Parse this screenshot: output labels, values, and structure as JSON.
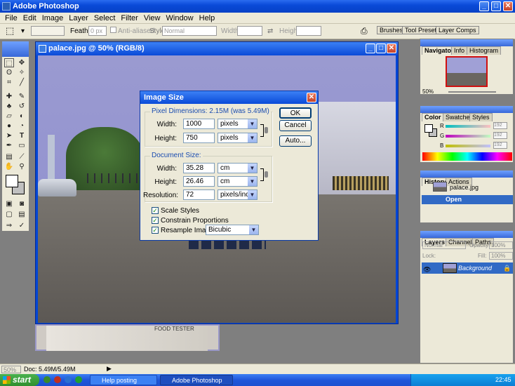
{
  "app": {
    "title": "Adobe Photoshop"
  },
  "menu": [
    "File",
    "Edit",
    "Image",
    "Layer",
    "Select",
    "Filter",
    "View",
    "Window",
    "Help"
  ],
  "options": {
    "feather_label": "Feather:",
    "feather_value": "0 px",
    "antialiased": "Anti-aliased",
    "style_label": "Style:",
    "style_value": "Normal",
    "width_label": "Width:",
    "height_label": "Height:"
  },
  "dock_tabs": [
    "Brushes",
    "Tool Presets",
    "Layer Comps"
  ],
  "document": {
    "title": "palace.jpg @ 50% (RGB/8)",
    "photo_text": "FOOD TESTER"
  },
  "dialog": {
    "title": "Image Size",
    "pixel_dimensions": "Pixel Dimensions:  2.15M (was 5.49M)",
    "px_width_label": "Width:",
    "px_width_value": "1000",
    "px_width_unit": "pixels",
    "px_height_label": "Height:",
    "px_height_value": "750",
    "px_height_unit": "pixels",
    "document_size": "Document Size:",
    "doc_width_label": "Width:",
    "doc_width_value": "35.28",
    "doc_width_unit": "cm",
    "doc_height_label": "Height:",
    "doc_height_value": "26.46",
    "doc_height_unit": "cm",
    "resolution_label": "Resolution:",
    "resolution_value": "72",
    "resolution_unit": "pixels/inch",
    "scale_styles": "Scale Styles",
    "constrain": "Constrain Proportions",
    "resample": "Resample Image:",
    "resample_method": "Bicubic",
    "ok": "OK",
    "cancel": "Cancel",
    "auto": "Auto..."
  },
  "navigator": {
    "tabs": [
      "Navigator",
      "Info",
      "Histogram"
    ],
    "zoom": "50%"
  },
  "color": {
    "tabs": [
      "Color",
      "Swatches",
      "Styles"
    ],
    "r_label": "R",
    "g_label": "G",
    "b_label": "B",
    "r": "192",
    "g": "192",
    "b": "192"
  },
  "history": {
    "tabs": [
      "History",
      "Actions"
    ],
    "snapshot": "palace.jpg",
    "item": "Open"
  },
  "layers": {
    "tabs": [
      "Layers",
      "Channels",
      "Paths"
    ],
    "blend": "Normal",
    "opacity_label": "Opacity:",
    "opacity": "100%",
    "lock_label": "Lock:",
    "fill_label": "Fill:",
    "fill": "100%",
    "layer_name": "Background"
  },
  "status": {
    "zoom": "50%",
    "doc": "Doc: 5.49M/5.49M"
  },
  "taskbar": {
    "start": "start",
    "task1": "Help posting photogr...",
    "task2": "Adobe Photoshop",
    "clock": "22:45"
  },
  "colors": {
    "xp_blue": "#0a4ad8",
    "sky": "#9a9ad0",
    "gradient_start": "#ff0000"
  }
}
